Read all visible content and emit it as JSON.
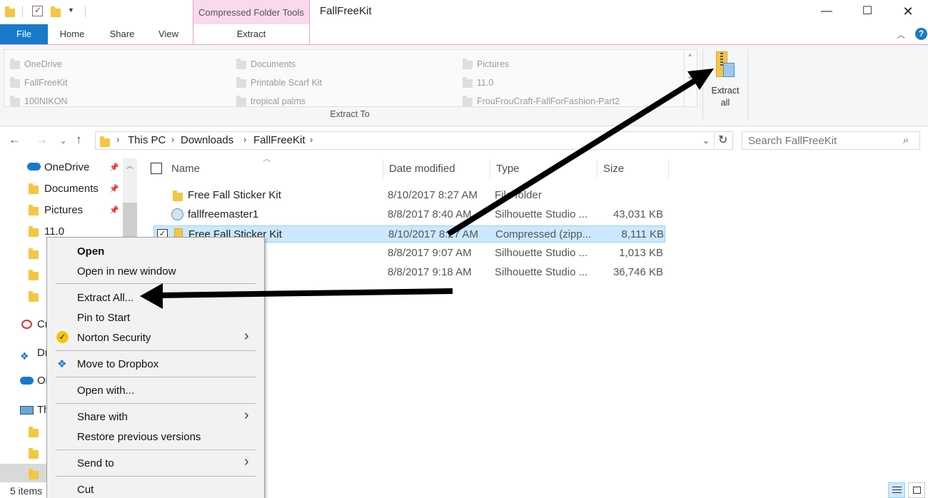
{
  "window": {
    "title": "FallFreeKit",
    "contextual_tab_group": "Compressed Folder Tools",
    "controls": [
      "minimize-icon",
      "maximize-icon",
      "close-icon"
    ]
  },
  "ribbon": {
    "tabs": [
      {
        "label": "File"
      },
      {
        "label": "Home"
      },
      {
        "label": "Share"
      },
      {
        "label": "View"
      },
      {
        "label": "Extract"
      }
    ],
    "extract_destinations": [
      [
        "OneDrive",
        "Documents",
        "Pictures"
      ],
      [
        "FallFreeKit",
        "Printable Scarf Kit",
        "11.0"
      ],
      [
        "100NIKON",
        "tropical palms",
        "FrouFrouCraft-FallForFashion-Part2"
      ]
    ],
    "group_label": "Extract To",
    "extract_all_label": [
      "Extract",
      "all"
    ]
  },
  "address_bar": {
    "breadcrumbs": [
      "This PC",
      "Downloads",
      "FallFreeKit"
    ],
    "search_placeholder": "Search FallFreeKit"
  },
  "nav_pane": {
    "quick_access": [
      {
        "label": "OneDrive",
        "pinned": true
      },
      {
        "label": "Documents",
        "pinned": true
      },
      {
        "label": "Pictures",
        "pinned": true
      },
      {
        "label": "11.0",
        "pinned": false
      }
    ],
    "partial_items": [
      "Cr",
      "Dr",
      "Or",
      "Th"
    ]
  },
  "file_list": {
    "columns": [
      "Name",
      "Date modified",
      "Type",
      "Size"
    ],
    "rows": [
      {
        "name": "Free Fall Sticker Kit",
        "date": "8/10/2017 8:27 AM",
        "type": "File folder",
        "size": "",
        "icon": "folder-icon",
        "selected": false
      },
      {
        "name": "fallfreemaster1",
        "date": "8/8/2017 8:40 AM",
        "type": "Silhouette Studio ...",
        "size": "43,031 KB",
        "icon": "studio-file-icon",
        "selected": false
      },
      {
        "name": "Free Fall Sticker Kit",
        "date": "8/10/2017 8:27 AM",
        "type": "Compressed (zipp...",
        "size": "8,111 KB",
        "icon": "zip-folder-icon",
        "selected": true
      },
      {
        "name": "",
        "date": "8/8/2017 9:07 AM",
        "type": "Silhouette Studio ...",
        "size": "1,013 KB",
        "icon": "studio-file-icon",
        "selected": false
      },
      {
        "name": "",
        "date": "8/8/2017 9:18 AM",
        "type": "Silhouette Studio ...",
        "size": "36,746 KB",
        "icon": "studio-file-icon",
        "selected": false
      }
    ]
  },
  "context_menu": {
    "items": [
      {
        "label": "Open",
        "bold": true
      },
      {
        "label": "Open in new window"
      },
      {
        "label": "Extract All..."
      },
      {
        "label": "Pin to Start"
      },
      {
        "label": "Norton Security",
        "submenu": true
      },
      {
        "label": "Move to Dropbox"
      },
      {
        "label": "Open with..."
      },
      {
        "label": "Share with",
        "submenu": true
      },
      {
        "label": "Restore previous versions"
      },
      {
        "label": "Send to",
        "submenu": true
      },
      {
        "label": "Cut"
      }
    ]
  },
  "status_bar": {
    "item_count": "5 items"
  },
  "colors": {
    "file_tab": "#1979ca",
    "contextual_tab": "#f9d9ec",
    "selection": "#cce8ff",
    "annotation_arrow": "#000000"
  }
}
